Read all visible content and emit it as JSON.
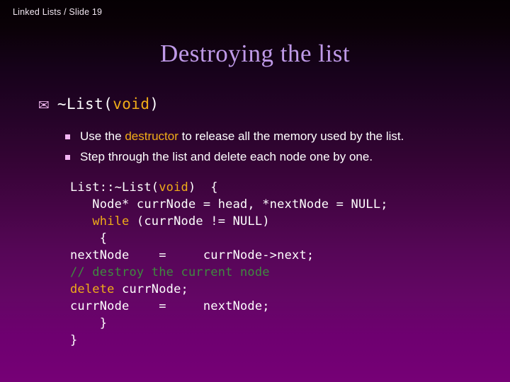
{
  "header": {
    "breadcrumb": "Linked Lists / Slide 19"
  },
  "title": "Destroying the list",
  "colors": {
    "title": "#bf9ae8",
    "keyword_orange": "#f0ac18",
    "comment_green": "#3f8a3f",
    "bullet_pink": "#f2b4f2",
    "text_white": "#ffffff",
    "background_top": "#050003",
    "background_bottom": "#760076"
  },
  "bullets": {
    "level1": {
      "marker": "envelope-icon",
      "marker_glyph": "✉",
      "parts": [
        {
          "text": "~List(",
          "style": "plain"
        },
        {
          "text": "void",
          "style": "keyword"
        },
        {
          "text": ")",
          "style": "plain"
        }
      ]
    },
    "level2": [
      {
        "marker": "square-bullet-icon",
        "parts": [
          {
            "text": "Use the ",
            "style": "plain"
          },
          {
            "text": "destructor",
            "style": "keyword"
          },
          {
            "text": " to release all the memory used by the list.",
            "style": "plain"
          }
        ]
      },
      {
        "marker": "square-bullet-icon",
        "parts": [
          {
            "text": "Step through the list and delete each node one by one.",
            "style": "plain"
          }
        ]
      }
    ]
  },
  "code": {
    "language": "cpp",
    "lines": [
      [
        {
          "text": "List::~List(",
          "style": "plain"
        },
        {
          "text": "void",
          "style": "keyword"
        },
        {
          "text": ")  {",
          "style": "plain"
        }
      ],
      [
        {
          "text": "   Node* currNode = head, *nextNode = NULL;",
          "style": "plain"
        }
      ],
      [
        {
          "text": "   ",
          "style": "plain"
        },
        {
          "text": "while",
          "style": "keyword"
        },
        {
          "text": " (currNode != NULL)",
          "style": "plain"
        }
      ],
      [
        {
          "text": "    {",
          "style": "plain"
        }
      ],
      [
        {
          "text": "nextNode    =     currNode->next;",
          "style": "plain"
        }
      ],
      [
        {
          "text": "// destroy the current node",
          "style": "comment"
        }
      ],
      [
        {
          "text": "delete",
          "style": "keyword"
        },
        {
          "text": " currNode;",
          "style": "plain"
        }
      ],
      [
        {
          "text": "currNode    =     nextNode;",
          "style": "plain"
        }
      ],
      [
        {
          "text": "    }",
          "style": "plain"
        }
      ],
      [
        {
          "text": "}",
          "style": "plain"
        }
      ]
    ]
  }
}
